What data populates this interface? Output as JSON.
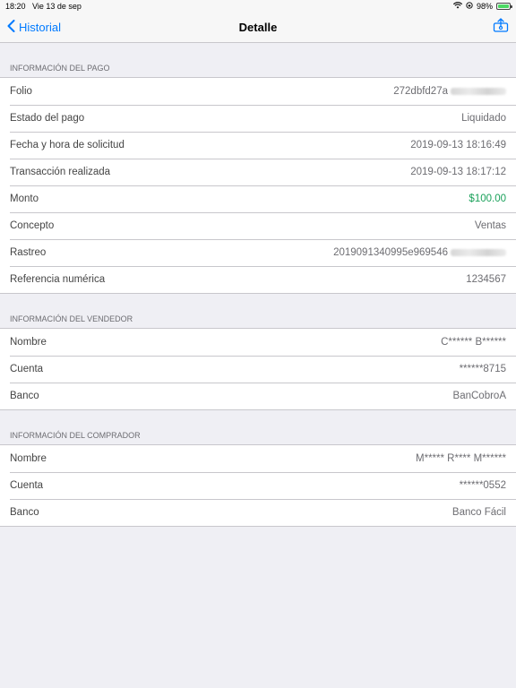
{
  "status": {
    "time": "18:20",
    "date": "Vie 13 de sep",
    "battery": "98%",
    "battery_level": 0.98
  },
  "nav": {
    "back_label": "Historial",
    "title": "Detalle"
  },
  "sections": {
    "pago": {
      "header": "Información del pago",
      "rows": [
        {
          "label": "Folio",
          "value": "272dbfd27a"
        },
        {
          "label": "Estado del pago",
          "value": "Liquidado"
        },
        {
          "label": "Fecha y hora de solicitud",
          "value": "2019-09-13 18:16:49"
        },
        {
          "label": "Transacción realizada",
          "value": "2019-09-13 18:17:12"
        },
        {
          "label": "Monto",
          "value": "$100.00"
        },
        {
          "label": "Concepto",
          "value": "Ventas"
        },
        {
          "label": "Rastreo",
          "value": "2019091340995e969546"
        },
        {
          "label": "Referencia numérica",
          "value": "1234567"
        }
      ]
    },
    "vendedor": {
      "header": "Información del vendedor",
      "rows": [
        {
          "label": "Nombre",
          "value": "C****** B******"
        },
        {
          "label": "Cuenta",
          "value": "******8715"
        },
        {
          "label": "Banco",
          "value": "BanCobroA"
        }
      ]
    },
    "comprador": {
      "header": "Información del comprador",
      "rows": [
        {
          "label": "Nombre",
          "value": "M***** R**** M******"
        },
        {
          "label": "Cuenta",
          "value": "******0552"
        },
        {
          "label": "Banco",
          "value": "Banco Fácil"
        }
      ]
    }
  },
  "colors": {
    "accent": "#007aff",
    "amount": "#1aa15a",
    "background": "#efeff4"
  },
  "icons": {
    "back": "chevron-left-icon",
    "share": "share-icon",
    "wifi": "wifi-icon",
    "battery": "battery-icon"
  }
}
